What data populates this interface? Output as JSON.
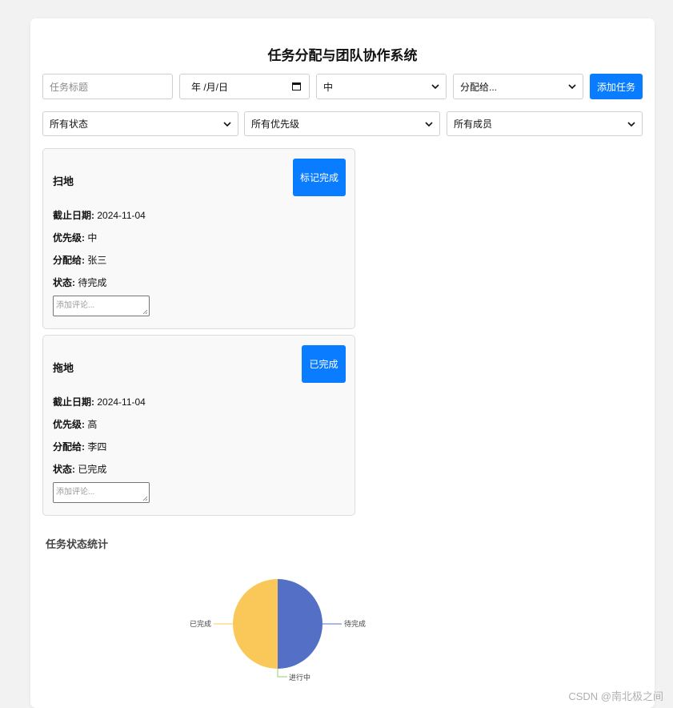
{
  "header": {
    "title": "任务分配与团队协作系统"
  },
  "task_form": {
    "title_placeholder": "任务标题",
    "date_placeholder": "年 /月/日",
    "priority_value": "中",
    "assignee_placeholder": "分配给...",
    "add_button": "添加任务"
  },
  "filters": {
    "status": "所有状态",
    "priority": "所有优先级",
    "member": "所有成员"
  },
  "labels": {
    "due": "截止日期:",
    "priority": "优先级:",
    "assignee": "分配给:",
    "status": "状态:"
  },
  "tasks": [
    {
      "title": "扫地",
      "action": "标记完成",
      "due": "2024-11-04",
      "priority": "中",
      "assignee": "张三",
      "status": "待完成",
      "comment_placeholder": "添加评论..."
    },
    {
      "title": "拖地",
      "action": "已完成",
      "due": "2024-11-04",
      "priority": "高",
      "assignee": "李四",
      "status": "已完成",
      "comment_placeholder": "添加评论..."
    }
  ],
  "stats": {
    "title": "任务状态统计",
    "chart_data": {
      "type": "pie",
      "categories": [
        "待完成",
        "进行中",
        "已完成"
      ],
      "values": [
        1,
        0,
        1
      ],
      "colors": [
        "#5470c6",
        "#91cc75",
        "#fac858"
      ]
    }
  },
  "watermark": "CSDN @南北极之间"
}
